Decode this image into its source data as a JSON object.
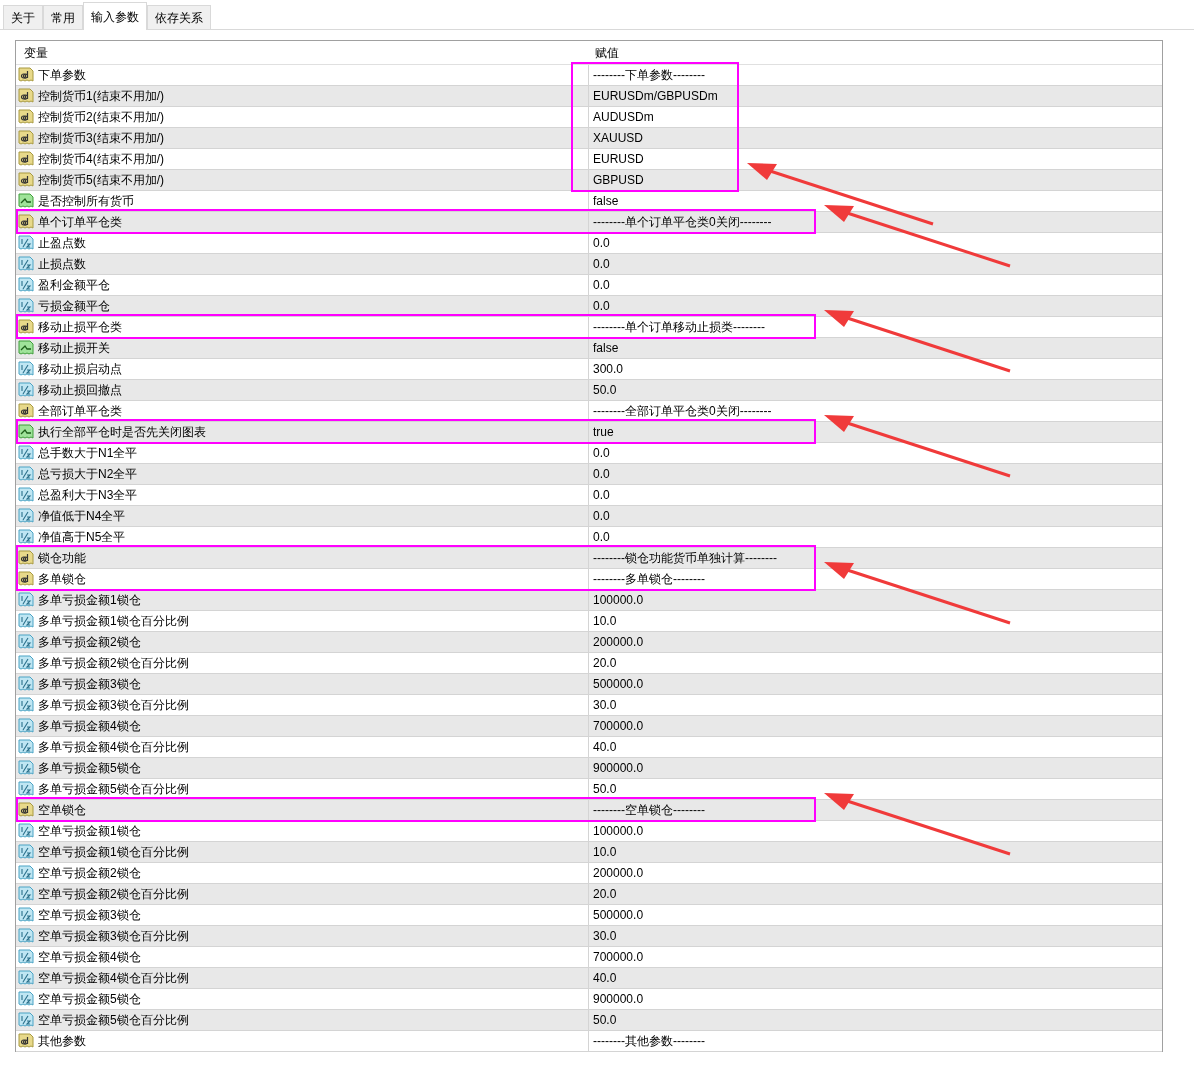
{
  "tabs": [
    {
      "label": "关于",
      "selected": false
    },
    {
      "label": "常用",
      "selected": false
    },
    {
      "label": "输入参数",
      "selected": true
    },
    {
      "label": "依存关系",
      "selected": false
    }
  ],
  "table": {
    "columns": [
      "变量",
      "赋值"
    ],
    "rows": [
      {
        "kind": "string",
        "name": "下单参数",
        "value": "--------下单参数--------",
        "frame_value": true,
        "frame_row": false
      },
      {
        "kind": "string",
        "name": "控制货币1(结束不用加/)",
        "value": "EURUSDm/GBPUSDm",
        "frame_value": true,
        "frame_row": false
      },
      {
        "kind": "string",
        "name": "控制货币2(结束不用加/)",
        "value": "AUDUSDm",
        "frame_value": true,
        "frame_row": false
      },
      {
        "kind": "string",
        "name": "控制货币3(结束不用加/)",
        "value": "XAUUSD",
        "frame_value": true,
        "frame_row": false
      },
      {
        "kind": "string",
        "name": "控制货币4(结束不用加/)",
        "value": "EURUSD",
        "frame_value": true,
        "frame_row": false
      },
      {
        "kind": "string",
        "name": "控制货币5(结束不用加/)",
        "value": "GBPUSD",
        "frame_value": true,
        "frame_row": false
      },
      {
        "kind": "bool",
        "name": "是否控制所有货币",
        "value": "false",
        "frame_value": false,
        "frame_row": false
      },
      {
        "kind": "string",
        "name": "单个订单平仓类",
        "value": "--------单个订单平仓类0关闭--------",
        "frame_value": false,
        "frame_row": true
      },
      {
        "kind": "number",
        "name": "止盈点数",
        "value": "0.0",
        "frame_value": false,
        "frame_row": false
      },
      {
        "kind": "number",
        "name": "止损点数",
        "value": "0.0",
        "frame_value": false,
        "frame_row": false
      },
      {
        "kind": "number",
        "name": "盈利金额平仓",
        "value": "0.0",
        "frame_value": false,
        "frame_row": false
      },
      {
        "kind": "number",
        "name": "亏损金额平仓",
        "value": "0.0",
        "frame_value": false,
        "frame_row": false
      },
      {
        "kind": "string",
        "name": "移动止损平仓类",
        "value": "--------单个订单移动止损类--------",
        "frame_value": false,
        "frame_row": true
      },
      {
        "kind": "bool",
        "name": "移动止损开关",
        "value": "false",
        "frame_value": false,
        "frame_row": false
      },
      {
        "kind": "number",
        "name": "移动止损启动点",
        "value": "300.0",
        "frame_value": false,
        "frame_row": false
      },
      {
        "kind": "number",
        "name": "移动止损回撤点",
        "value": "50.0",
        "frame_value": false,
        "frame_row": false
      },
      {
        "kind": "string",
        "name": "全部订单平仓类",
        "value": "--------全部订单平仓类0关闭--------",
        "frame_value": false,
        "frame_row": false
      },
      {
        "kind": "bool",
        "name": "执行全部平仓时是否先关闭图表",
        "value": "true",
        "frame_value": false,
        "frame_row": true
      },
      {
        "kind": "number",
        "name": "总手数大于N1全平",
        "value": "0.0",
        "frame_value": false,
        "frame_row": false
      },
      {
        "kind": "number",
        "name": "总亏损大于N2全平",
        "value": "0.0",
        "frame_value": false,
        "frame_row": false
      },
      {
        "kind": "number",
        "name": "总盈利大于N3全平",
        "value": "0.0",
        "frame_value": false,
        "frame_row": false
      },
      {
        "kind": "number",
        "name": "净值低于N4全平",
        "value": "0.0",
        "frame_value": false,
        "frame_row": false
      },
      {
        "kind": "number",
        "name": "净值高于N5全平",
        "value": "0.0",
        "frame_value": false,
        "frame_row": false
      },
      {
        "kind": "string",
        "name": "锁仓功能",
        "value": "--------锁仓功能货币单独计算--------",
        "frame_value": false,
        "frame_row": true
      },
      {
        "kind": "string",
        "name": "多单锁仓",
        "value": "--------多单锁仓--------",
        "frame_value": false,
        "frame_row": true
      },
      {
        "kind": "number",
        "name": "多单亏损金额1锁仓",
        "value": "100000.0",
        "frame_value": false,
        "frame_row": false
      },
      {
        "kind": "number",
        "name": "多单亏损金额1锁仓百分比例",
        "value": "10.0",
        "frame_value": false,
        "frame_row": false
      },
      {
        "kind": "number",
        "name": "多单亏损金额2锁仓",
        "value": "200000.0",
        "frame_value": false,
        "frame_row": false
      },
      {
        "kind": "number",
        "name": "多单亏损金额2锁仓百分比例",
        "value": "20.0",
        "frame_value": false,
        "frame_row": false
      },
      {
        "kind": "number",
        "name": "多单亏损金额3锁仓",
        "value": "500000.0",
        "frame_value": false,
        "frame_row": false
      },
      {
        "kind": "number",
        "name": "多单亏损金额3锁仓百分比例",
        "value": "30.0",
        "frame_value": false,
        "frame_row": false
      },
      {
        "kind": "number",
        "name": "多单亏损金额4锁仓",
        "value": "700000.0",
        "frame_value": false,
        "frame_row": false
      },
      {
        "kind": "number",
        "name": "多单亏损金额4锁仓百分比例",
        "value": "40.0",
        "frame_value": false,
        "frame_row": false
      },
      {
        "kind": "number",
        "name": "多单亏损金额5锁仓",
        "value": "900000.0",
        "frame_value": false,
        "frame_row": false
      },
      {
        "kind": "number",
        "name": "多单亏损金额5锁仓百分比例",
        "value": "50.0",
        "frame_value": false,
        "frame_row": false
      },
      {
        "kind": "string",
        "name": "空单锁仓",
        "value": "--------空单锁仓--------",
        "frame_value": false,
        "frame_row": true
      },
      {
        "kind": "number",
        "name": "空单亏损金额1锁仓",
        "value": "100000.0",
        "frame_value": false,
        "frame_row": false
      },
      {
        "kind": "number",
        "name": "空单亏损金额1锁仓百分比例",
        "value": "10.0",
        "frame_value": false,
        "frame_row": false
      },
      {
        "kind": "number",
        "name": "空单亏损金额2锁仓",
        "value": "200000.0",
        "frame_value": false,
        "frame_row": false
      },
      {
        "kind": "number",
        "name": "空单亏损金额2锁仓百分比例",
        "value": "20.0",
        "frame_value": false,
        "frame_row": false
      },
      {
        "kind": "number",
        "name": "空单亏损金额3锁仓",
        "value": "500000.0",
        "frame_value": false,
        "frame_row": false
      },
      {
        "kind": "number",
        "name": "空单亏损金额3锁仓百分比例",
        "value": "30.0",
        "frame_value": false,
        "frame_row": false
      },
      {
        "kind": "number",
        "name": "空单亏损金额4锁仓",
        "value": "700000.0",
        "frame_value": false,
        "frame_row": false
      },
      {
        "kind": "number",
        "name": "空单亏损金额4锁仓百分比例",
        "value": "40.0",
        "frame_value": false,
        "frame_row": false
      },
      {
        "kind": "number",
        "name": "空单亏损金额5锁仓",
        "value": "900000.0",
        "frame_value": false,
        "frame_row": false
      },
      {
        "kind": "number",
        "name": "空单亏损金额5锁仓百分比例",
        "value": "50.0",
        "frame_value": false,
        "frame_row": false
      },
      {
        "kind": "string",
        "name": "其他参数",
        "value": "--------其他参数--------",
        "frame_value": false,
        "frame_row": false
      }
    ]
  }
}
